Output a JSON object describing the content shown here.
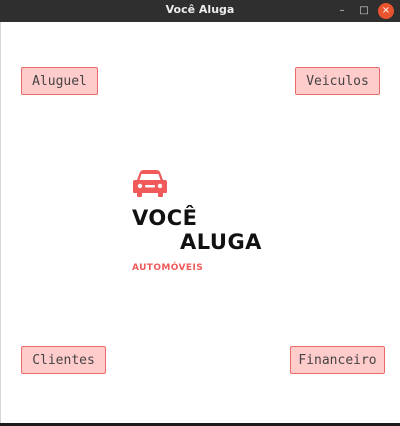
{
  "window": {
    "title": "Você Aluga",
    "controls": {
      "minimize": "–",
      "maximize": "□",
      "close": "×"
    }
  },
  "buttons": {
    "aluguel": "Aluguel",
    "veiculos": "Veiculos",
    "clientes": "Clientes",
    "financeiro": "Financeiro"
  },
  "logo": {
    "icon": "car-icon",
    "line1": "VOCÊ",
    "line2": "ALUGA",
    "subtitle": "AUTOMÓVEIS",
    "accent_color": "#f05a5a",
    "text_color": "#111111"
  },
  "colors": {
    "button_bg": "#ffcccc",
    "button_border": "#e86a6a",
    "titlebar": "#2f2f2f",
    "close_button": "#e9542f"
  }
}
